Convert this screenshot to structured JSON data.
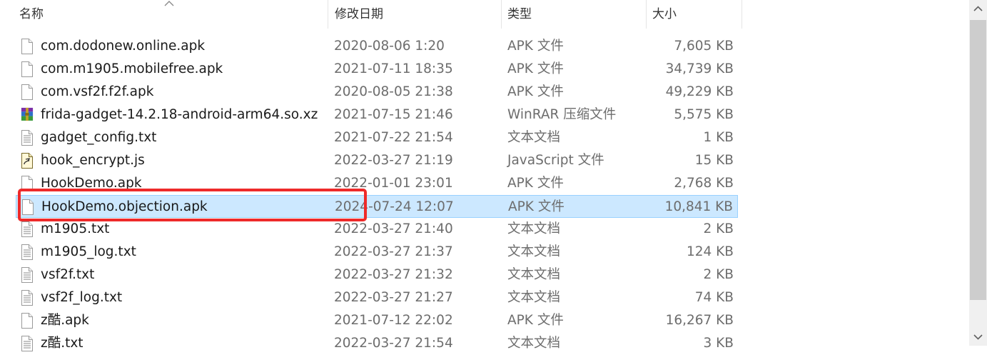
{
  "header": {
    "name": "名称",
    "date": "修改日期",
    "type": "类型",
    "size": "大小"
  },
  "files": [
    {
      "name": "com.dodonew.online.apk",
      "date": "2020-08-06 1:20",
      "type": "APK 文件",
      "size": "7,605 KB",
      "icon": "generic-file-icon"
    },
    {
      "name": "com.m1905.mobilefree.apk",
      "date": "2021-07-11 18:35",
      "type": "APK 文件",
      "size": "34,739 KB",
      "icon": "generic-file-icon"
    },
    {
      "name": "com.vsf2f.f2f.apk",
      "date": "2020-08-05 21:38",
      "type": "APK 文件",
      "size": "49,229 KB",
      "icon": "generic-file-icon"
    },
    {
      "name": "frida-gadget-14.2.18-android-arm64.so.xz",
      "date": "2021-07-15 21:46",
      "type": "WinRAR 压缩文件",
      "size": "5,575 KB",
      "icon": "winrar-archive-icon"
    },
    {
      "name": "gadget_config.txt",
      "date": "2021-07-22 21:54",
      "type": "文本文档",
      "size": "1 KB",
      "icon": "text-document-icon"
    },
    {
      "name": "hook_encrypt.js",
      "date": "2022-03-27 21:19",
      "type": "JavaScript 文件",
      "size": "15 KB",
      "icon": "script-file-icon"
    },
    {
      "name": "HookDemo.apk",
      "date": "2022-01-01 23:01",
      "type": "APK 文件",
      "size": "2,768 KB",
      "icon": "generic-file-icon"
    },
    {
      "name": "HookDemo.objection.apk",
      "date": "2024-07-24 12:07",
      "type": "APK 文件",
      "size": "10,841 KB",
      "icon": "generic-file-icon",
      "selected": true
    },
    {
      "name": "m1905.txt",
      "date": "2022-03-27 21:40",
      "type": "文本文档",
      "size": "2 KB",
      "icon": "text-document-icon"
    },
    {
      "name": "m1905_log.txt",
      "date": "2022-03-27 21:37",
      "type": "文本文档",
      "size": "124 KB",
      "icon": "text-document-icon"
    },
    {
      "name": "vsf2f.txt",
      "date": "2022-03-27 21:32",
      "type": "文本文档",
      "size": "2 KB",
      "icon": "text-document-icon"
    },
    {
      "name": "vsf2f_log.txt",
      "date": "2022-03-27 21:27",
      "type": "文本文档",
      "size": "74 KB",
      "icon": "text-document-icon"
    },
    {
      "name": "z酷.apk",
      "date": "2021-07-12 22:02",
      "type": "APK 文件",
      "size": "16,267 KB",
      "icon": "generic-file-icon"
    },
    {
      "name": "z酷.txt",
      "date": "2022-03-27 21:54",
      "type": "文本文档",
      "size": "3 KB",
      "icon": "text-document-icon"
    }
  ],
  "colors": {
    "selection_bg": "#cce8ff",
    "selection_border": "#99d1ff",
    "annotation": "#ee2a2a",
    "secondary_text": "#6d6d6d"
  }
}
